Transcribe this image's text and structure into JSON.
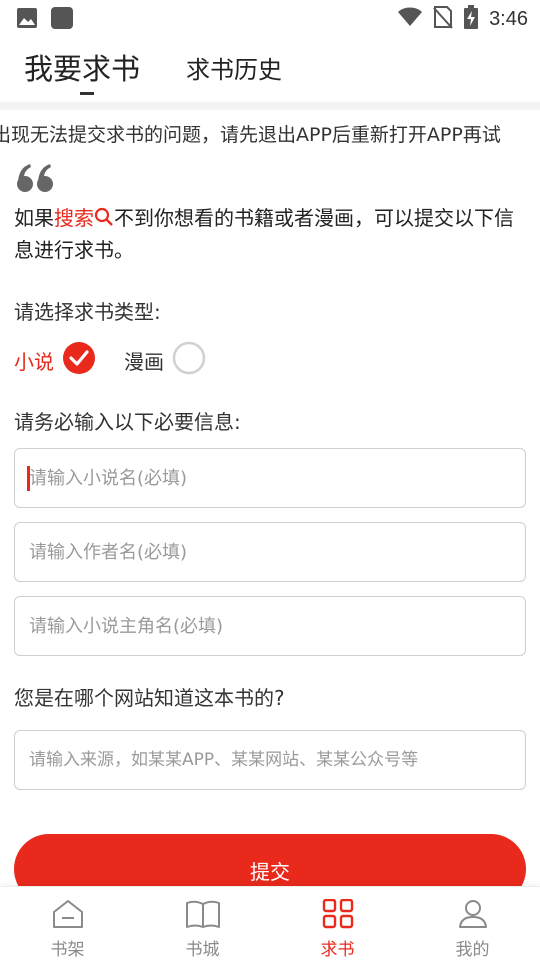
{
  "status_bar": {
    "time": "3:46",
    "icons": [
      "image-icon",
      "app-icon",
      "wifi-icon",
      "no-sim-icon",
      "battery-charging-icon"
    ]
  },
  "tabs": {
    "active_label": "我要求书",
    "inactive_label": "求书历史"
  },
  "notice": {
    "marquee_text": "出现无法提交求书的问题，请先退出APP后重新打开APP再试"
  },
  "intro": {
    "prefix": "如果",
    "highlight": "搜索",
    "suffix": "不到你想看的书籍或者漫画，可以提交以下信息进行求书。"
  },
  "type_section": {
    "label": "请选择求书类型:",
    "options": [
      {
        "label": "小说",
        "selected": true
      },
      {
        "label": "漫画",
        "selected": false
      }
    ]
  },
  "required_section": {
    "label": "请务必输入以下必要信息:",
    "fields": [
      {
        "placeholder": "请输入小说名(必填)",
        "value": ""
      },
      {
        "placeholder": "请输入作者名(必填)",
        "value": ""
      },
      {
        "placeholder": "请输入小说主角名(必填)",
        "value": ""
      }
    ]
  },
  "source_section": {
    "label": "您是在哪个网站知道这本书的?",
    "placeholder": "请输入来源，如某某APP、某某网站、某某公众号等",
    "value": ""
  },
  "submit": {
    "label": "提交"
  },
  "bottom_nav": {
    "items": [
      {
        "label": "书架",
        "icon": "bookshelf-icon",
        "active": false
      },
      {
        "label": "书城",
        "icon": "book-icon",
        "active": false
      },
      {
        "label": "求书",
        "icon": "request-grid-icon",
        "active": true
      },
      {
        "label": "我的",
        "icon": "profile-icon",
        "active": false
      }
    ]
  },
  "colors": {
    "accent": "#e8291c",
    "text": "#333333",
    "placeholder": "#9a9a9a",
    "nav_inactive": "#8a8a8a"
  }
}
